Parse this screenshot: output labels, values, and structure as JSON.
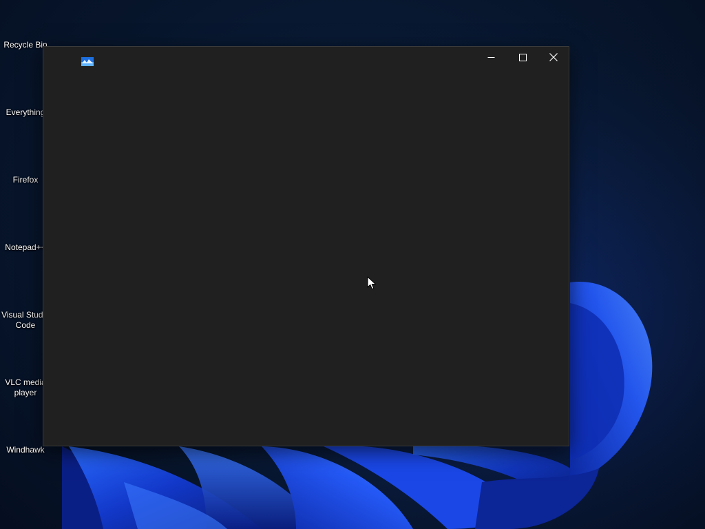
{
  "desktop": {
    "icons": [
      {
        "label": "Recycle Bin",
        "icon": "recycle-bin-icon"
      },
      {
        "label": "Everything",
        "icon": "everything-icon"
      },
      {
        "label": "Firefox",
        "icon": "firefox-icon"
      },
      {
        "label": "Notepad++",
        "icon": "notepad-plus-plus-icon"
      },
      {
        "label": "Visual Studio Code",
        "icon": "vscode-icon"
      },
      {
        "label": "VLC media player",
        "icon": "vlc-icon"
      },
      {
        "label": "Windhawk",
        "icon": "windhawk-icon"
      }
    ],
    "accent_color": "#1f4fe0"
  },
  "window": {
    "title": "",
    "icon": "app-icon",
    "background_color": "#202020",
    "controls": {
      "minimize": "minimize-icon",
      "maximize": "maximize-icon",
      "close": "close-icon"
    }
  },
  "cursor": {
    "icon": "arrow-cursor-icon"
  }
}
